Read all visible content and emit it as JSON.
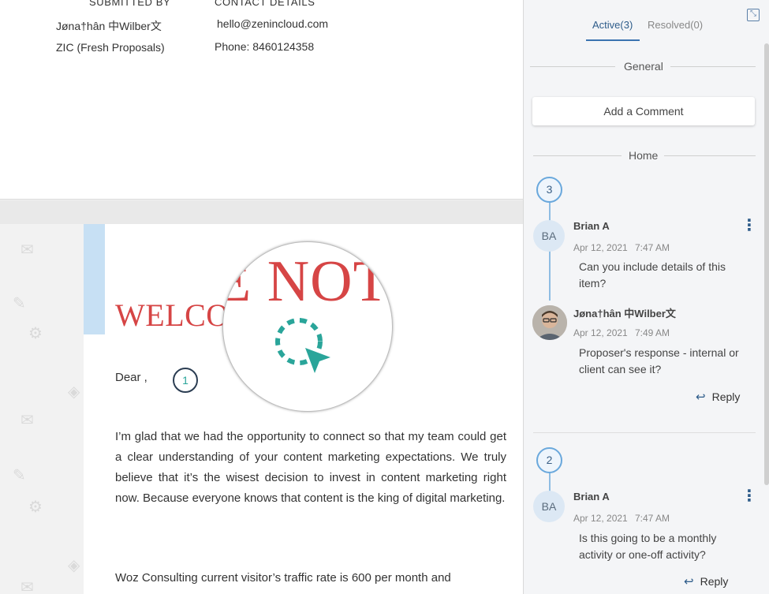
{
  "header": {
    "submitted_by_label": "SUBMITTED BY",
    "contact_details_label": "CONTACT DETAILS",
    "submitter_name": "Jøna†hân 中Wilber文",
    "submitter_org": "ZIC (Fresh Proposals)",
    "contact_email": "hello@zenincloud.com",
    "contact_phone": "Phone: 8460124358"
  },
  "document": {
    "heading": "WELCO",
    "magnified_heading": "E NOT",
    "salutation": "Dear  ,",
    "comment_marker": "1",
    "paragraph_1": "I’m glad that we had the opportunity to connect so that my team could get a clear understanding of your content marketing expectations. We truly believe that it’s the wisest decision to invest in content marketing right now. Because everyone knows that content is the king of digital marketing.",
    "paragraph_2": "Woz Consulting current visitor’s traffic rate is 600 per month and"
  },
  "panel": {
    "tabs": [
      {
        "label": "Active(3)",
        "active": true
      },
      {
        "label": "Resolved(0)",
        "active": false
      }
    ],
    "section_general": "General",
    "add_comment_label": "Add a Comment",
    "section_home": "Home",
    "threads": [
      {
        "count": "3",
        "comments": [
          {
            "initials": "BA",
            "author": "Brian A",
            "date": "Apr 12, 2021",
            "time": "7:47 AM",
            "text": "Can you include details of this item?"
          },
          {
            "initials": "",
            "author": "Jøna†hân 中Wilber文",
            "date": "Apr 12, 2021",
            "time": "7:49 AM",
            "text": "Proposer's response - internal or client can see it?"
          }
        ],
        "reply_label": "Reply"
      },
      {
        "count": "2",
        "comments": [
          {
            "initials": "BA",
            "author": "Brian A",
            "date": "Apr 12, 2021",
            "time": "7:47 AM",
            "text": "Is this going to be a monthly activity or one-off activity?"
          }
        ],
        "reply_label": "Reply"
      }
    ]
  },
  "icons": [
    "mail-icon",
    "pencil-icon",
    "gear-icon",
    "puzzle-icon",
    "expand-icon",
    "more-vertical-icon",
    "reply-icon",
    "cursor-icon"
  ],
  "colors": {
    "heading_red": "#d64545",
    "accent_blue": "#3a73b0",
    "thread_blue": "#8ebde3",
    "cursor_teal": "#2aa59a"
  }
}
